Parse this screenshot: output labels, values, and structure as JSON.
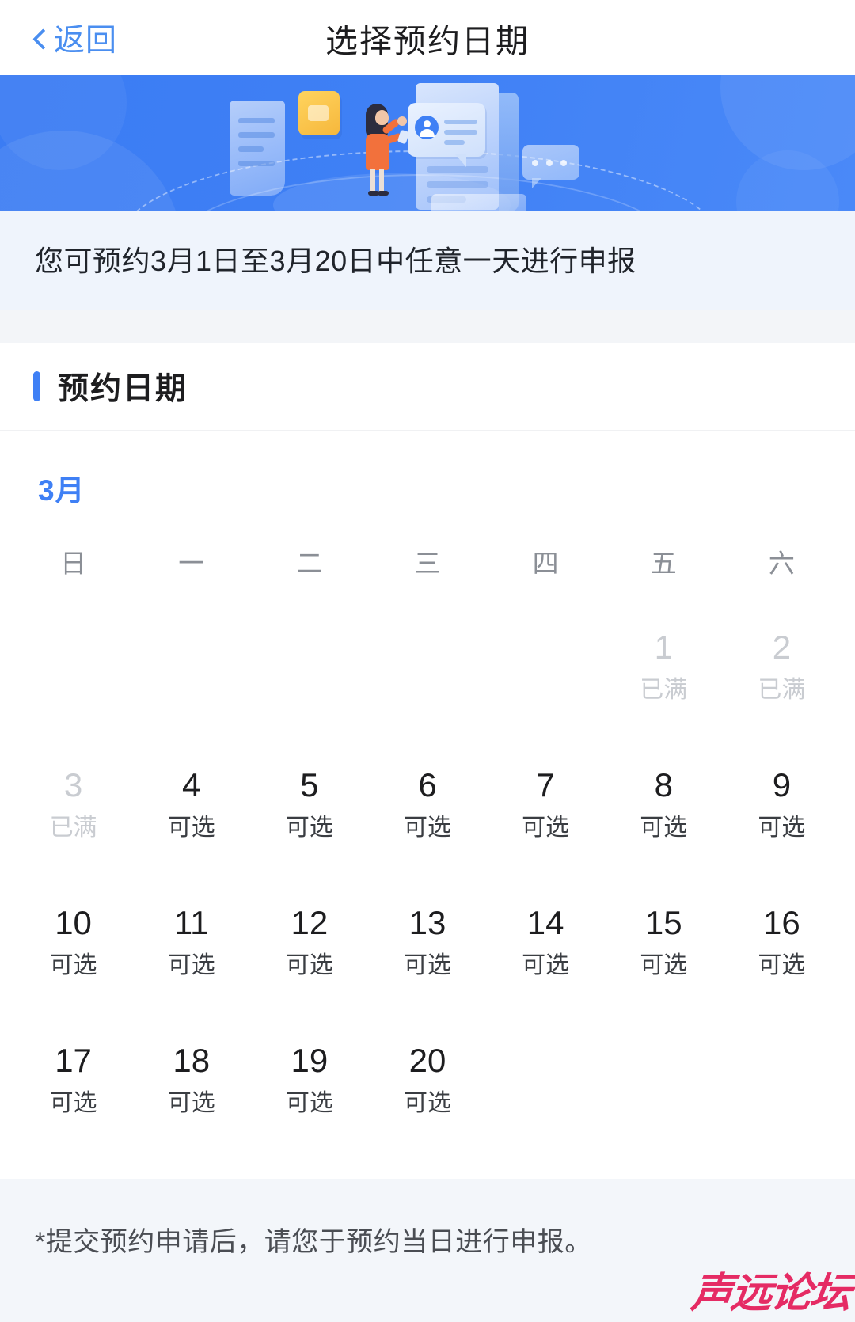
{
  "header": {
    "back_label": "返回",
    "title": "选择预约日期",
    "back_icon": "chevron-left-icon"
  },
  "banner": {
    "alt": "appointment-illustration",
    "base_color": "#3f80f5",
    "accent_color": "#f2713c",
    "folder_color": "#f6b73c"
  },
  "notice": {
    "text": "您可预约3月1日至3月20日中任意一天进行申报",
    "background": "#eff4fc"
  },
  "section": {
    "title": "预约日期",
    "accent_color": "#3f80f5"
  },
  "calendar": {
    "month_label": "3月",
    "month_color": "#3f80f5",
    "weekdays": [
      "日",
      "一",
      "二",
      "三",
      "四",
      "五",
      "六"
    ],
    "leading_blanks": 5,
    "status_labels": {
      "available": "可选",
      "full": "已满"
    },
    "days": [
      {
        "num": "1",
        "status": "full",
        "label": "已满"
      },
      {
        "num": "2",
        "status": "full",
        "label": "已满"
      },
      {
        "num": "3",
        "status": "full",
        "label": "已满"
      },
      {
        "num": "4",
        "status": "available",
        "label": "可选"
      },
      {
        "num": "5",
        "status": "available",
        "label": "可选"
      },
      {
        "num": "6",
        "status": "available",
        "label": "可选"
      },
      {
        "num": "7",
        "status": "available",
        "label": "可选"
      },
      {
        "num": "8",
        "status": "available",
        "label": "可选"
      },
      {
        "num": "9",
        "status": "available",
        "label": "可选"
      },
      {
        "num": "10",
        "status": "available",
        "label": "可选"
      },
      {
        "num": "11",
        "status": "available",
        "label": "可选"
      },
      {
        "num": "12",
        "status": "available",
        "label": "可选"
      },
      {
        "num": "13",
        "status": "available",
        "label": "可选"
      },
      {
        "num": "14",
        "status": "available",
        "label": "可选"
      },
      {
        "num": "15",
        "status": "available",
        "label": "可选"
      },
      {
        "num": "16",
        "status": "available",
        "label": "可选"
      },
      {
        "num": "17",
        "status": "available",
        "label": "可选"
      },
      {
        "num": "18",
        "status": "available",
        "label": "可选"
      },
      {
        "num": "19",
        "status": "available",
        "label": "可选"
      },
      {
        "num": "20",
        "status": "available",
        "label": "可选"
      }
    ]
  },
  "footer": {
    "note": "*提交预约申请后，请您于预约当日进行申报。",
    "watermark": "声远论坛",
    "watermark_color": "#e5215c"
  }
}
